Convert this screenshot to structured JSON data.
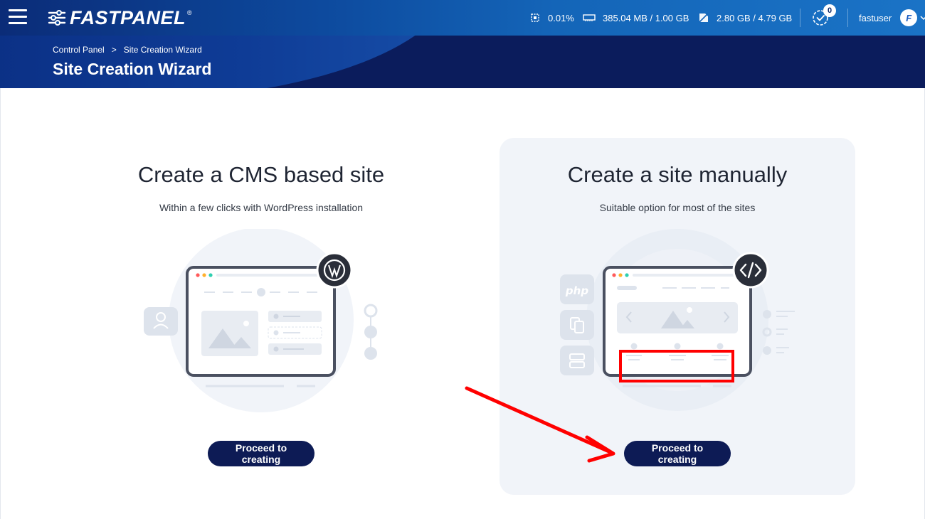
{
  "app": {
    "name": "FASTPANEL",
    "registered_mark": "®"
  },
  "topbar": {
    "stats": {
      "cpu": "0.01%",
      "ram": "385.04 MB / 1.00 GB",
      "disk": "2.80 GB / 4.79 GB"
    },
    "tasks_count": "0",
    "username": "fastuser",
    "avatar_letter": "F"
  },
  "breadcrumb": {
    "home": "Control Panel",
    "separator": ">",
    "current": "Site Creation Wizard"
  },
  "page_title": "Site Creation Wizard",
  "cards": {
    "cms": {
      "title": "Create a CMS based site",
      "subtitle": "Within a few clicks with WordPress installation",
      "button": "Proceed to creating"
    },
    "manual": {
      "title": "Create a site manually",
      "subtitle": "Suitable option for most of the sites",
      "button": "Proceed to creating",
      "php_label": "php"
    }
  },
  "colors": {
    "topbar_start": "#0b2c78",
    "topbar_end": "#1a73c6",
    "band": "#0b1c5c",
    "button": "#0d1b55",
    "highlight": "#ff0000"
  },
  "icons": [
    "hamburger-icon",
    "cpu-icon",
    "ram-icon",
    "disk-icon",
    "tasks-icon",
    "chevron-down-icon",
    "chevron-right-icon",
    "wordpress-icon",
    "code-icon",
    "user-icon",
    "copy-icon",
    "server-icon",
    "image-icon"
  ]
}
